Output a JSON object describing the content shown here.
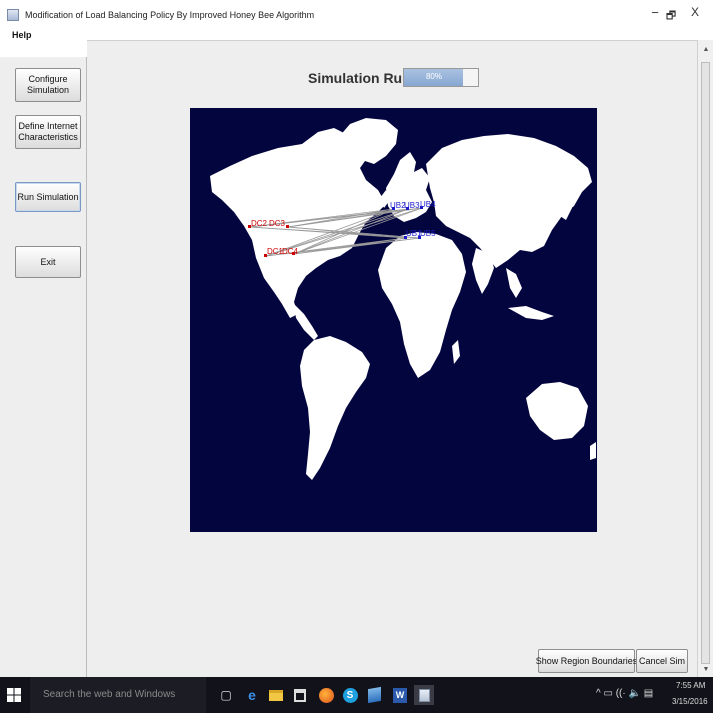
{
  "window": {
    "title": "Modification of Load Balancing Policy By Improved Honey Bee Algorithm",
    "minimize": "−",
    "restore": "🗗",
    "close": "X"
  },
  "menu": {
    "help": "Help"
  },
  "sidebar": {
    "configure": "Configure Simulation",
    "define_internet": "Define Internet Characteristics",
    "run": "Run Simulation",
    "exit": "Exit"
  },
  "status": {
    "label": "Simulation Running...",
    "progress_text": "80%",
    "progress_fraction": 0.8
  },
  "map": {
    "datacenters": [
      {
        "label": "DC2",
        "color": "#cc0000"
      },
      {
        "label": "DC3",
        "color": "#cc0000"
      },
      {
        "label": "DC1",
        "color": "#cc0000"
      },
      {
        "label": "DC4",
        "color": "#cc0000"
      }
    ],
    "userbases": [
      {
        "label": "UB2"
      },
      {
        "label": "UB3"
      },
      {
        "label": "UB4"
      },
      {
        "label": "UB1"
      },
      {
        "label": "UB5"
      }
    ],
    "link_color": "#9a9a9a",
    "ocean_color": "#03053f",
    "land_color": "#ffffff"
  },
  "buttons": {
    "show_regions": "Show Region Boundaries",
    "cancel": "Cancel Sim"
  },
  "taskbar": {
    "search_placeholder": "Search the web and Windows",
    "time": "7:55 AM",
    "date": "3/15/2016",
    "tray": "^ ▭ ((· 🔈 ▤"
  }
}
